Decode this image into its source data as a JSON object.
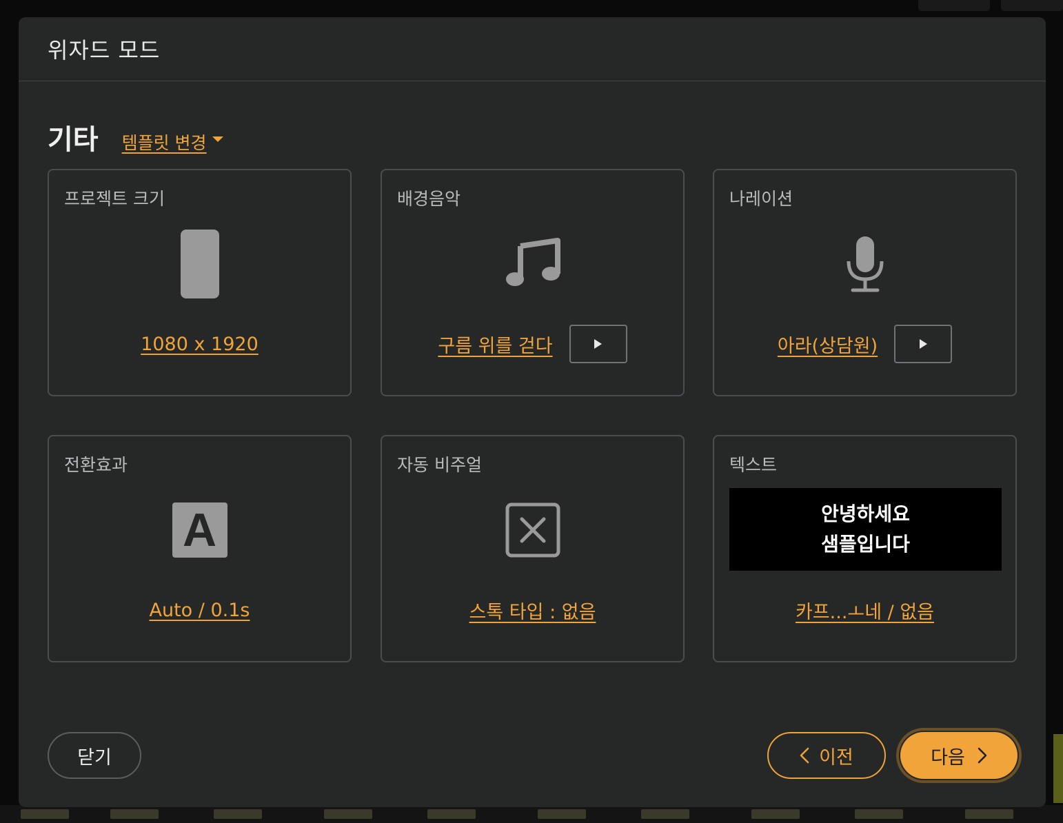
{
  "modal": {
    "title": "위자드 모드"
  },
  "section": {
    "title": "기타",
    "template_link": "템플릿 변경"
  },
  "cards": {
    "project_size": {
      "label": "프로젝트 크기",
      "value": "1080 x 1920"
    },
    "bgm": {
      "label": "배경음악",
      "value": "구름 위를 걷다"
    },
    "narration": {
      "label": "나레이션",
      "value": "아라(상담원)"
    },
    "transition": {
      "label": "전환효과",
      "value": "Auto / 0.1s",
      "icon_letter": "A"
    },
    "auto_visual": {
      "label": "자동 비주얼",
      "value": "스톡 타입 : 없음"
    },
    "text": {
      "label": "텍스트",
      "preview_line1": "안녕하세요",
      "preview_line2": "샘플입니다",
      "value": "카프...ㅗ네 / 없음"
    }
  },
  "footer": {
    "close_label": "닫기",
    "prev_label": "이전",
    "next_label": "다음"
  },
  "icons": {
    "project_size": "phone-portrait-icon",
    "bgm": "music-note-icon",
    "narration": "microphone-icon",
    "transition": "letter-a-icon",
    "auto_visual": "x-box-icon",
    "play": "play-icon",
    "prev": "chevron-left-icon",
    "next": "chevron-right-icon",
    "dropdown": "caret-down-icon"
  },
  "colors": {
    "accent": "#f0a43a",
    "modal_bg": "#262727",
    "border": "#4a4d4f"
  }
}
